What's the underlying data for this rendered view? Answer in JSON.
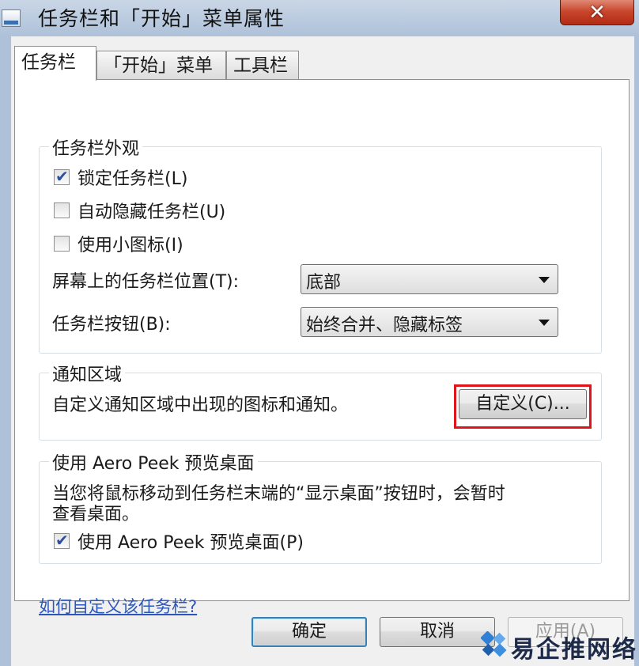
{
  "window": {
    "title": "任务栏和「开始」菜单属性",
    "close_glyph": "✕"
  },
  "tabs": [
    {
      "label": "任务栏",
      "active": true
    },
    {
      "label": "「开始」菜单",
      "active": false
    },
    {
      "label": "工具栏",
      "active": false
    }
  ],
  "appearance": {
    "title": "任务栏外观",
    "lock_taskbar": {
      "label": "锁定任务栏(L)",
      "checked": true
    },
    "auto_hide": {
      "label": "自动隐藏任务栏(U)",
      "checked": false
    },
    "small_icons": {
      "label": "使用小图标(I)",
      "checked": false
    },
    "location_label": "屏幕上的任务栏位置(T):",
    "location_value": "底部",
    "buttons_label": "任务栏按钮(B):",
    "buttons_value": "始终合并、隐藏标签"
  },
  "notification": {
    "title": "通知区域",
    "description": "自定义通知区域中出现的图标和通知。",
    "customize_button": "自定义(C)..."
  },
  "aero_peek": {
    "title": "使用 Aero Peek 预览桌面",
    "description_line1": "当您将鼠标移动到任务栏末端的“显示桌面”按钮时，会暂时",
    "description_line2": "查看桌面。",
    "checkbox": {
      "label": "使用 Aero Peek 预览桌面(P)",
      "checked": true
    }
  },
  "help_link": "如何自定义该任务栏?",
  "buttons": {
    "ok": "确定",
    "cancel": "取消",
    "apply": "应用(A)"
  },
  "watermark": "易企推网络",
  "colors": {
    "highlight": "#e0141b",
    "link": "#2c56b8",
    "checkmark": "#2d4fa3"
  }
}
